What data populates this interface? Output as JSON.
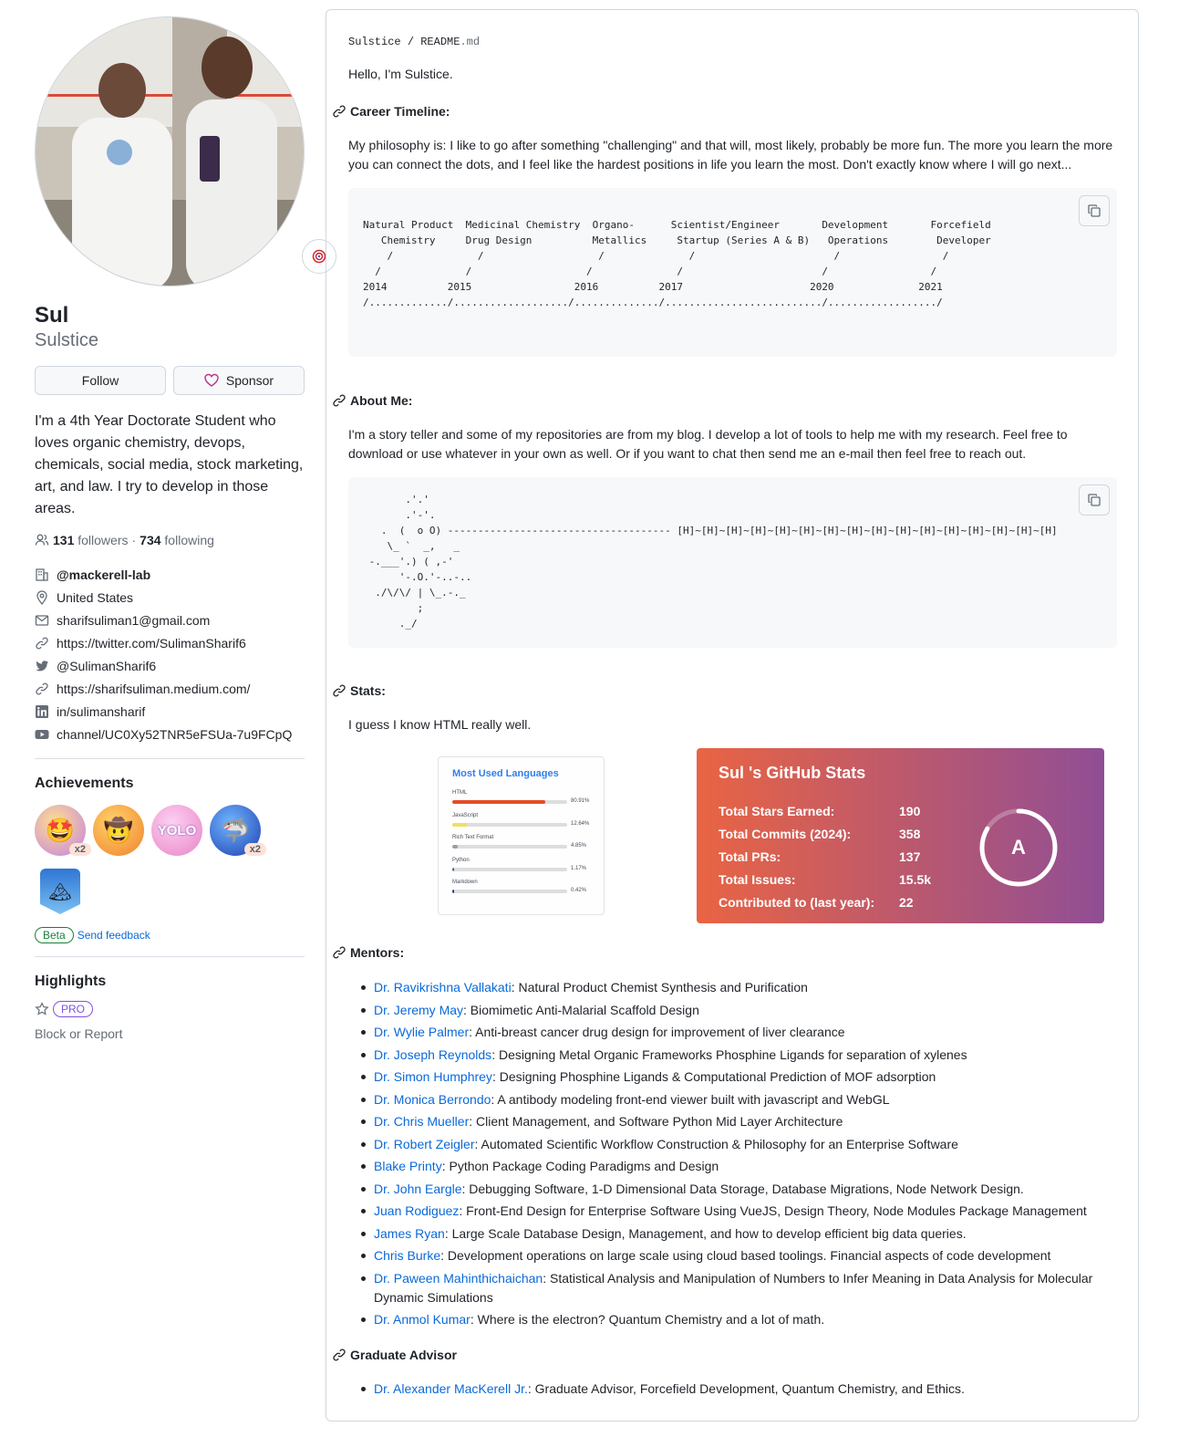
{
  "profile": {
    "name": "Sul",
    "login": "Sulstice",
    "follow_label": "Follow",
    "sponsor_label": "Sponsor",
    "bio": "I'm a 4th Year Doctorate Student who loves organic chemistry, devops, chemicals, social media, stock marketing, art, and law. I try to develop in those areas.",
    "followers_count": "131",
    "followers_label": "followers",
    "separator": "·",
    "following_count": "734",
    "following_label": "following",
    "details": {
      "org": "@mackerell-lab",
      "location": "United States",
      "email": "sharifsuliman1@gmail.com",
      "twitter_url": "https://twitter.com/SulimanSharif6",
      "twitter_handle": "@SulimanSharif6",
      "blog": "https://sharifsuliman.medium.com/",
      "linkedin": "in/sulimansharif",
      "youtube": "channel/UC0Xy52TNR5eFSUa-7u9FCpQ"
    },
    "achievements_title": "Achievements",
    "achievement_multiplier": "x2",
    "beta_label": "Beta",
    "feedback_label": "Send feedback",
    "highlights_title": "Highlights",
    "pro_label": "PRO",
    "block_label": "Block or Report"
  },
  "readme": {
    "crumb_user": "Sulstice",
    "crumb_sep": "/",
    "crumb_file": "README",
    "crumb_ext": ".md",
    "greeting": "Hello, I'm Sulstice.",
    "career_heading": "Career Timeline:",
    "philosophy": "My philosophy is: I like to go after something \"challenging\" and that will, most likely, probably be more fun. The more you learn the more you can connect the dots, and I feel like the hardest positions in life you learn the most. Don't exactly know where I will go next...",
    "timeline_ascii": "Natural Product  Medicinal Chemistry  Organo-      Scientist/Engineer       Development       Forcefield\n   Chemistry     Drug Design          Metallics     Startup (Series A & B)   Operations        Developer\n    /              /                   /              /                       /                 /\n  /              /                   /              /                       /                 /\n2014          2015                 2016          2017                     2020              2021\n/............./.................../............../........................../................../",
    "about_heading": "About Me:",
    "about_text": "I'm a story teller and some of my repositories are from my blog. I develop a lot of tools to help me with my research. Feel free to download or use whatever in your own as well. Or if you want to chat then send me an e-mail then feel free to reach out.",
    "about_ascii": "       .'.'\n       .'-'.\n   .  (  o O) ------------------------------------- [H]~[H]~[H]~[H]~[H]~[H]~[H]~[H]~[H]~[H]~[H]~[H]~[H]~[H]~[H]~[H]\n    \\_ `  _,   _\n -.___'.) ( ,-'\n      '-.O.'-..-..\n  ./\\/\\/ | \\_.-._\n         ;\n      ._/",
    "stats_heading": "Stats:",
    "stats_text": "I guess I know HTML really well.",
    "mentors_heading": "Mentors:",
    "mentors": [
      {
        "name": "Dr. Ravikrishna Vallakati",
        "desc": ": Natural Product Chemist Synthesis and Purification"
      },
      {
        "name": "Dr. Jeremy May",
        "desc": ": Biomimetic Anti-Malarial Scaffold Design"
      },
      {
        "name": "Dr. Wylie Palmer",
        "desc": ": Anti-breast cancer drug design for improvement of liver clearance"
      },
      {
        "name": "Dr. Joseph Reynolds",
        "desc": ": Designing Metal Organic Frameworks Phosphine Ligands for separation of xylenes"
      },
      {
        "name": "Dr. Simon Humphrey",
        "desc": ": Designing Phosphine Ligands & Computational Prediction of MOF adsorption"
      },
      {
        "name": "Dr. Monica Berrondo",
        "desc": ": A antibody modeling front-end viewer built with javascript and WebGL"
      },
      {
        "name": "Dr. Chris Mueller",
        "desc": ": Client Management, and Software Python Mid Layer Architecture"
      },
      {
        "name": "Dr. Robert Zeigler",
        "desc": ": Automated Scientific Workflow Construction & Philosophy for an Enterprise Software"
      },
      {
        "name": "Blake Printy",
        "desc": ": Python Package Coding Paradigms and Design"
      },
      {
        "name": "Dr. John Eargle",
        "desc": ": Debugging Software, 1-D Dimensional Data Storage, Database Migrations, Node Network Design."
      },
      {
        "name": "Juan Rodiguez",
        "desc": ": Front-End Design for Enterprise Software Using VueJS, Design Theory, Node Modules Package Management"
      },
      {
        "name": "James Ryan",
        "desc": ": Large Scale Database Design, Management, and how to develop efficient big data queries."
      },
      {
        "name": "Chris Burke",
        "desc": ": Development operations on large scale using cloud based toolings. Financial aspects of code development"
      },
      {
        "name": "Dr. Paween Mahinthichaichan",
        "desc": ": Statistical Analysis and Manipulation of Numbers to Infer Meaning in Data Analysis for Molecular Dynamic Simulations"
      },
      {
        "name": "Dr. Anmol Kumar",
        "desc": ": Where is the electron? Quantum Chemistry and a lot of math."
      }
    ],
    "advisor_heading": "Graduate Advisor",
    "advisor": {
      "name": "Dr. Alexander MacKerell Jr.",
      "desc": ": Graduate Advisor, Forcefield Development, Quantum Chemistry, and Ethics."
    }
  },
  "languages_card": {
    "title": "Most Used Languages",
    "items": [
      {
        "name": "HTML",
        "pct": "80.91%",
        "value": 80.91,
        "color": "#e34c26"
      },
      {
        "name": "JavaScript",
        "pct": "12.64%",
        "value": 12.64,
        "color": "#f1e05a"
      },
      {
        "name": "Rich Text Format",
        "pct": "4.85%",
        "value": 4.85,
        "color": "#9e9e9e"
      },
      {
        "name": "Python",
        "pct": "1.17%",
        "value": 1.17,
        "color": "#3572A5"
      },
      {
        "name": "Markdown",
        "pct": "0.42%",
        "value": 0.42,
        "color": "#083fa1"
      }
    ]
  },
  "stats_card": {
    "title": "Sul 's GitHub Stats",
    "rows": [
      {
        "label": "Total Stars Earned:",
        "value": "190"
      },
      {
        "label": "Total Commits (2024):",
        "value": "358"
      },
      {
        "label": "Total PRs:",
        "value": "137"
      },
      {
        "label": "Total Issues:",
        "value": "15.5k"
      },
      {
        "label": "Contributed to (last year):",
        "value": "22"
      }
    ],
    "rank": "A",
    "gradient_start": "#e96443",
    "gradient_end": "#904e95"
  },
  "colors": {
    "accent_link": "#0969da",
    "text": "#1f2328",
    "muted": "#656d76",
    "border": "#d0d7de"
  }
}
